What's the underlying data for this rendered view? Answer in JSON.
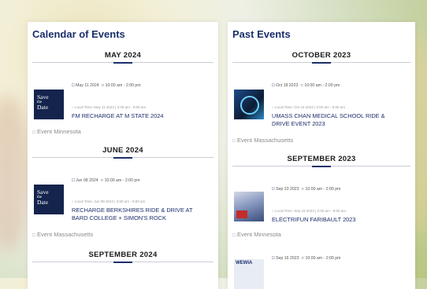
{
  "left": {
    "title": "Calendar of Events",
    "sections": [
      {
        "month": "MAY 2024",
        "event": {
          "thumb_text": [
            "Save",
            "the",
            "Date"
          ],
          "date": "May 11 2024",
          "time": "10:00 am - 2:00 pm",
          "local_time": "Local Time: May 11 2024 | 3:00 am - 9:00 am",
          "title_lines": [
            "FM RECHARGE AT M STATE 2024"
          ],
          "category": "Event Minnesota"
        }
      },
      {
        "month": "JUNE 2024",
        "event": {
          "thumb_text": [
            "Save",
            "the",
            "Date"
          ],
          "date": "Jun 08 2024",
          "time": "10:00 am - 2:00 pm",
          "local_time": "Local Time: Jun 08 2024 | 3:00 am - 9:00 am",
          "title_lines": [
            "RECHARGE BERKSHIRES RIDE & DRIVE AT",
            "BARD COLLEGE + SIMON'S ROCK"
          ],
          "category": "Event Massachusetts"
        }
      },
      {
        "month": "SEPTEMBER 2024"
      }
    ]
  },
  "right": {
    "title": "Past Events",
    "sections": [
      {
        "month": "OCTOBER 2023",
        "event": {
          "date": "Oct 18 2023",
          "time": "10:00 am - 2:00 pm",
          "local_time": "Local Time: Oct 18 2023 | 3:00 am - 9:00 am",
          "title_lines": [
            "UMASS CHAN MEDICAL SCHOOL RIDE &",
            "DRIVE EVENT 2023"
          ],
          "category": "Event Massachusetts"
        }
      },
      {
        "month": "SEPTEMBER 2023",
        "event": {
          "date": "Sep 23 2023",
          "time": "10:00 am - 2:00 pm",
          "local_time": "Local Time: Sep 23 2023 | 3:00 am - 9:00 am",
          "title_lines": [
            "ELECTRIFUN FARIBAULT 2023"
          ],
          "category": "Event Minnesota"
        }
      },
      {
        "event": {
          "thumb_text": "WEWIA",
          "date": "Sep 16 2023",
          "time": "10:00 am - 2:00 pm"
        }
      }
    ]
  },
  "icons": {
    "calendar": "calendar-icon",
    "clock": "clock-icon",
    "folder": "folder-icon"
  },
  "colors": {
    "accent": "#1b2f6b",
    "save_bg": "#14244d"
  }
}
